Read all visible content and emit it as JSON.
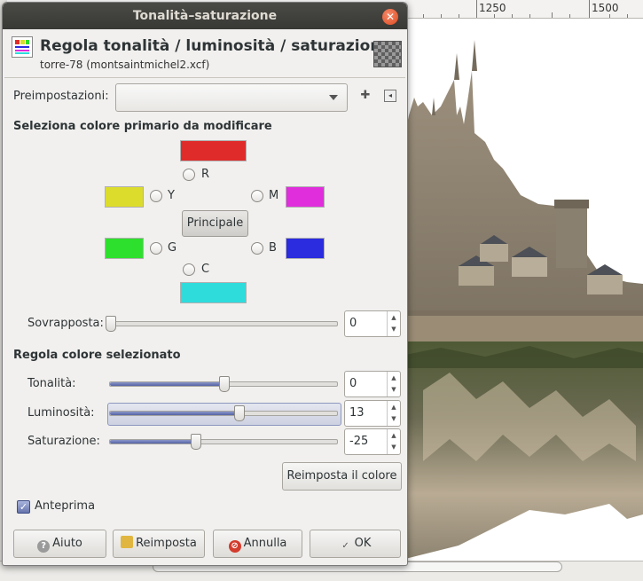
{
  "ruler": {
    "ticks": [
      "1250",
      "1500"
    ]
  },
  "dialog": {
    "window_title": "Tonalità–saturazione",
    "close_glyph": "✕",
    "header_title": "Regola tonalità / luminosità / saturazione",
    "header_subtitle": "torre-78 (montsaintmichel2.xcf)",
    "presets_label": "Preimpostazioni:",
    "presets_value": "",
    "add_preset_glyph": "✚",
    "preset_menu_glyph": "◂",
    "primary_section_title": "Seleziona colore primario da modificare",
    "primaries": [
      {
        "key": "R",
        "color": "#e02b2b"
      },
      {
        "key": "Y",
        "color": "#dcdc2c"
      },
      {
        "key": "M",
        "color": "#e02edc"
      },
      {
        "key": "G",
        "color": "#2ee02e"
      },
      {
        "key": "B",
        "color": "#2b2be0"
      },
      {
        "key": "C",
        "color": "#2edcdc"
      }
    ],
    "master_button": "Principale",
    "overlap": {
      "label": "Sovrapposta:",
      "value": "0",
      "fraction": 0.0
    },
    "adjust_section_title": "Regola colore selezionato",
    "hue": {
      "label": "Tonalità:",
      "value": "0",
      "fraction": 0.5
    },
    "lightness": {
      "label": "Luminosità:",
      "value": "13",
      "fraction": 0.565
    },
    "saturation": {
      "label": "Saturazione:",
      "value": "-25",
      "fraction": 0.375
    },
    "reset_color_button": "Reimposta il colore",
    "preview": {
      "label": "Anteprima",
      "checked": true,
      "check_glyph": "✓"
    },
    "buttons": {
      "help": "Aiuto",
      "reset": "Reimposta",
      "cancel": "Annulla",
      "ok": "OK"
    },
    "icons": {
      "help_glyph": "?",
      "cancel_glyph": "⊘",
      "ok_glyph": "✓"
    }
  }
}
